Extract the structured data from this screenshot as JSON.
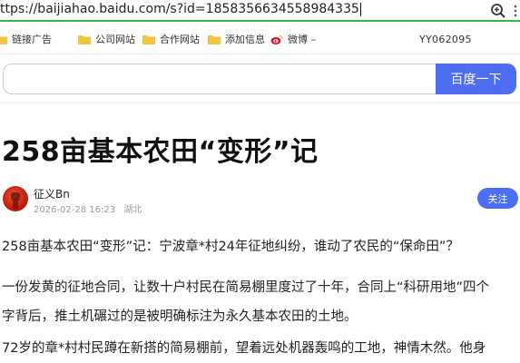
{
  "browser": {
    "url": "https://baijiahao.baidu.com/s?id=1858356634558984335",
    "url_visible": "ttps://baijiahao.baidu.com/s?id=1858356634558984335"
  },
  "bookmarks": [
    {
      "label": "链接广告"
    },
    {
      "label": "公司网站"
    },
    {
      "label": "合作网站"
    },
    {
      "label": "添加信息"
    },
    {
      "label": "微博 –"
    }
  ],
  "bookmark_id_text": "YY062095",
  "search": {
    "value": "",
    "button_label": "百度一下"
  },
  "article": {
    "title": "258亩基本农田“变形”记",
    "author": "征义Bn",
    "date": "2026-02-28 16:23",
    "location": "湖北",
    "follow_label": "关注",
    "paragraphs": [
      [
        "258亩基本农田“变形”记：宁波章*村24年征地纠纷，谁动了农民的“保命田”？"
      ],
      [
        "一份发黄的征地合同，让数十户村民在简易棚里度过了十年，合同上“科研用地”四个",
        "字背后，推土机碾过的是被明确标注为永久基本农田的土地。"
      ],
      [
        "72岁的章*村村民蹲在新搭的简易棚前，望着远处机器轰鸣的工地，神情木然。他身"
      ]
    ]
  },
  "colors": {
    "accent": "#4e6ef2",
    "address_underline": "#3bb34a",
    "folder": "#f5c342",
    "meta": "#9a9a9a"
  }
}
